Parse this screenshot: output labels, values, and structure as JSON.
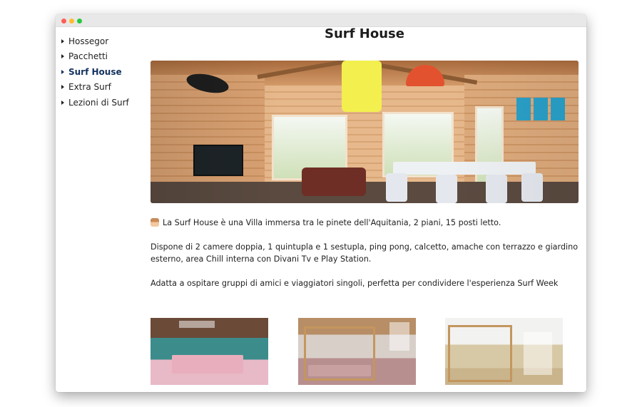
{
  "window": {
    "controls": [
      "close",
      "minimize",
      "zoom"
    ]
  },
  "sidebar": {
    "items": [
      {
        "label": "Hossegor",
        "active": false
      },
      {
        "label": "Pacchetti",
        "active": false
      },
      {
        "label": "Surf House",
        "active": true
      },
      {
        "label": "Extra Surf",
        "active": false
      },
      {
        "label": "Lezioni di Surf",
        "active": false
      }
    ]
  },
  "main": {
    "title": "Surf House",
    "paragraphs": [
      "La Surf House è una Villa immersa tra le pinete dell'Aquitania, 2 piani, 15 posti letto.",
      "Dispone di 2 camere doppia, 1 quintupla e 1 sestupla, ping pong, calcetto, amache con terrazzo e giardino esterno, area Chill interna con Divani Tv e Play Station.",
      "Adatta a ospitare gruppi di amici e viaggiatori singoli, perfetta per condividere l'esperienza Surf Week"
    ],
    "hero_image": "living-room-photo",
    "thumbnails": [
      "double-bedroom-photo",
      "bunk-bedroom-photo",
      "bunk-room-with-terrace-photo"
    ]
  },
  "colors": {
    "active_nav": "#13325e",
    "text": "#222222",
    "titlebar": "#e8e8e8"
  }
}
